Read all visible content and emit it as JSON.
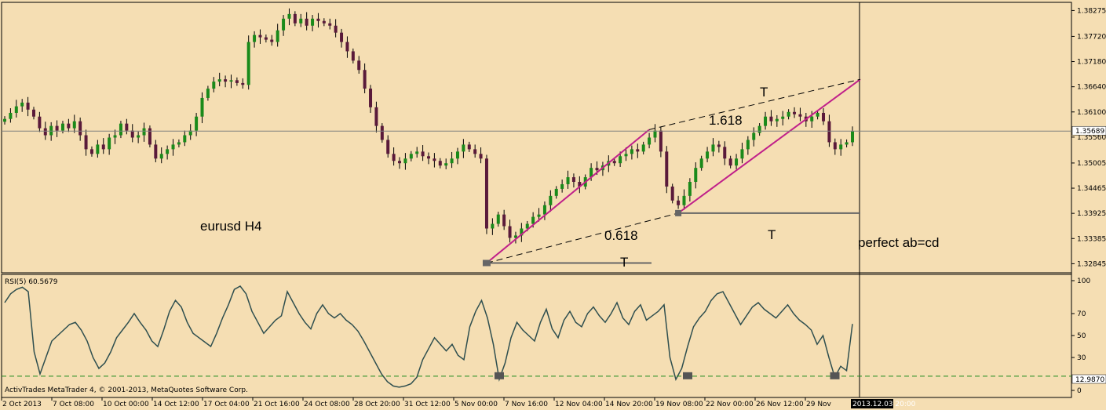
{
  "price_panel": {
    "symbol_label": "eurusd H4",
    "price_ticks": [
      "1.38275",
      "1.37720",
      "1.37180",
      "1.36640",
      "1.36100",
      "1.35560",
      "1.35005",
      "1.34465",
      "1.33925",
      "1.33385",
      "1.32845"
    ],
    "current_price": "1.35689",
    "annotations": {
      "fib_1618": "1.618",
      "fib_0618": "0.618",
      "t_upper": "T",
      "t_middle": "T",
      "t_bottom": "T",
      "pattern_note": "perfect ab=cd"
    }
  },
  "rsi_panel": {
    "title": "RSI(5) 60.5679",
    "ticks": [
      "100",
      "70",
      "50",
      "30",
      "0"
    ],
    "current_value": "12.9870",
    "copyright": "ActivTrades MetaTrader 4, © 2001-2013, MetaQuotes Software Corp."
  },
  "time_axis": {
    "labels": [
      "2 Oct 2013",
      "7 Oct 08:00",
      "10 Oct 00:00",
      "14 Oct 12:00",
      "17 Oct 04:00",
      "21 Oct 16:00",
      "24 Oct 08:00",
      "28 Oct 20:00",
      "31 Oct 12:00",
      "5 Nov 00:00",
      "7 Nov 16:00",
      "12 Nov 04:00",
      "14 Nov 20:00",
      "19 Nov 08:00",
      "22 Nov 00:00",
      "26 Nov 12:00",
      "29 Nov"
    ],
    "cursor_label": "2013.12.03 20:00"
  },
  "colors": {
    "background": "#f5deb3",
    "bull_candle": "#1a8a1a",
    "bear_candle": "#5a1a3a",
    "wick": "#000000",
    "ab_cd_line": "#c0208a",
    "rsi_line": "#2f4f4f",
    "level_line": "#1a8a1a"
  },
  "chart_data": [
    {
      "type": "candlestick",
      "title": "eurusd H4",
      "ylim": [
        1.3265,
        1.3845
      ],
      "close_series": [
        1.3595,
        1.3608,
        1.3622,
        1.363,
        1.3615,
        1.36,
        1.3575,
        1.356,
        1.358,
        1.357,
        1.3585,
        1.3575,
        1.359,
        1.356,
        1.353,
        1.352,
        1.354,
        1.353,
        1.3555,
        1.356,
        1.3585,
        1.357,
        1.3555,
        1.356,
        1.3575,
        1.354,
        1.351,
        1.352,
        1.353,
        1.354,
        1.3545,
        1.356,
        1.357,
        1.36,
        1.364,
        1.366,
        1.3675,
        1.368,
        1.3675,
        1.3678,
        1.3672,
        1.3668,
        1.376,
        1.3775,
        1.377,
        1.3765,
        1.376,
        1.3785,
        1.381,
        1.382,
        1.38,
        1.381,
        1.3795,
        1.381,
        1.3805,
        1.38,
        1.3795,
        1.378,
        1.376,
        1.374,
        1.372,
        1.37,
        1.366,
        1.362,
        1.358,
        1.355,
        1.352,
        1.3505,
        1.35,
        1.351,
        1.352,
        1.3525,
        1.3515,
        1.351,
        1.3505,
        1.3495,
        1.35,
        1.351,
        1.3525,
        1.354,
        1.353,
        1.352,
        1.351,
        1.336,
        1.337,
        1.339,
        1.3365,
        1.334,
        1.3345,
        1.336,
        1.337,
        1.3385,
        1.339,
        1.341,
        1.343,
        1.3445,
        1.3455,
        1.347,
        1.346,
        1.345,
        1.347,
        1.349,
        1.3485,
        1.3495,
        1.3505,
        1.35,
        1.3515,
        1.352,
        1.353,
        1.3525,
        1.354,
        1.3555,
        1.357,
        1.3525,
        1.345,
        1.342,
        1.341,
        1.343,
        1.346,
        1.349,
        1.351,
        1.3525,
        1.354,
        1.3535,
        1.351,
        1.3495,
        1.351,
        1.353,
        1.355,
        1.3565,
        1.358,
        1.36,
        1.359,
        1.3595,
        1.36,
        1.361,
        1.3605,
        1.36,
        1.359,
        1.36,
        1.3608,
        1.359,
        1.3545,
        1.353,
        1.354,
        1.3545,
        1.3569
      ],
      "reference_levels": [
        {
          "label": "T",
          "price": 1.3286
        },
        {
          "label": "T",
          "price": 1.3393
        }
      ],
      "ab_cd": {
        "fib_a": 0.618,
        "fib_b": 1.618
      }
    },
    {
      "type": "line",
      "title": "RSI(5) 60.5679",
      "ylim": [
        0,
        100
      ],
      "y_ticks": [
        0,
        30,
        50,
        70,
        100
      ],
      "level": 12.987,
      "values": [
        80,
        88,
        92,
        94,
        90,
        35,
        15,
        30,
        45,
        50,
        55,
        60,
        62,
        55,
        45,
        30,
        20,
        25,
        35,
        48,
        55,
        62,
        70,
        62,
        55,
        45,
        40,
        55,
        72,
        82,
        76,
        62,
        52,
        48,
        44,
        40,
        52,
        66,
        78,
        92,
        95,
        88,
        72,
        62,
        52,
        58,
        64,
        68,
        90,
        80,
        70,
        62,
        56,
        70,
        78,
        70,
        66,
        70,
        64,
        60,
        54,
        45,
        35,
        25,
        15,
        8,
        4,
        3,
        4,
        6,
        12,
        28,
        38,
        48,
        42,
        36,
        42,
        32,
        28,
        58,
        72,
        82,
        66,
        42,
        10,
        25,
        48,
        62,
        55,
        50,
        45,
        62,
        74,
        56,
        48,
        64,
        72,
        62,
        58,
        70,
        76,
        68,
        62,
        70,
        80,
        66,
        60,
        72,
        78,
        64,
        68,
        72,
        78,
        30,
        10,
        20,
        40,
        58,
        66,
        72,
        82,
        88,
        90,
        80,
        70,
        60,
        68,
        76,
        80,
        74,
        70,
        66,
        72,
        78,
        70,
        64,
        60,
        55,
        42,
        50,
        30,
        12,
        22,
        18,
        60.5679
      ]
    }
  ]
}
